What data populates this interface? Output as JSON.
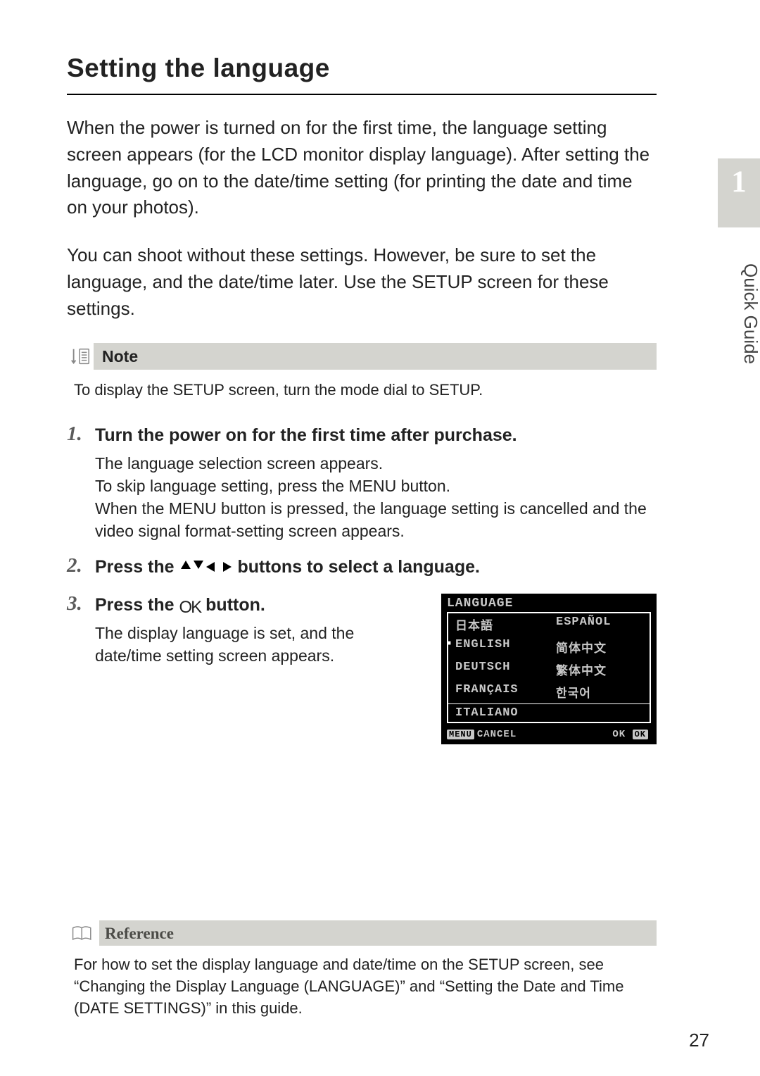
{
  "sidebar": {
    "chapter_num": "1",
    "chapter_label": "Quick Guide"
  },
  "page_number": "27",
  "heading": "Setting the language",
  "intro_p1": "When the power is turned on for the first time, the language setting screen appears (for the LCD monitor display language). After setting the language, go on to the date/time setting (for printing the date and time on your photos).",
  "intro_p2": "You can shoot without these settings. However, be sure to set the language, and the date/time later. Use the SETUP screen for these settings.",
  "note": {
    "title": "Note",
    "body": "To display the SETUP screen, turn the mode dial to SETUP."
  },
  "steps": [
    {
      "num": "1.",
      "title": "Turn the power on for the first time after purchase.",
      "desc": "The language selection screen appears.\nTo skip language setting, press the MENU button.\nWhen the MENU button is pressed, the language setting is cancelled and the video signal format-setting screen appears."
    },
    {
      "num": "2.",
      "title_pre": "Press the ",
      "title_post": " buttons to select a language."
    },
    {
      "num": "3.",
      "title_pre": "Press the ",
      "ok_label": "O",
      "title_post": " button.",
      "desc": "The display language is set, and the date/time setting screen appears."
    }
  ],
  "lcd": {
    "title": "LANGUAGE",
    "rows": [
      {
        "l": "日本語",
        "r": "ESPAÑOL"
      },
      {
        "l": "ENGLISH",
        "r": "简体中文",
        "selected": true
      },
      {
        "l": "DEUTSCH",
        "r": "繁体中文"
      },
      {
        "l": "FRANÇAIS",
        "r": "한국어"
      },
      {
        "l": "ITALIANO",
        "r": ""
      }
    ],
    "foot_left_btn": "MENU",
    "foot_left_lbl": "CANCEL",
    "foot_right_lbl": "OK",
    "foot_right_btn": "OK"
  },
  "reference": {
    "title": "Reference",
    "body": "For how to set the display language and date/time on the SETUP screen, see “Changing the Display Language (LANGUAGE)” and “Setting the Date and Time (DATE SETTINGS)” in this guide."
  }
}
